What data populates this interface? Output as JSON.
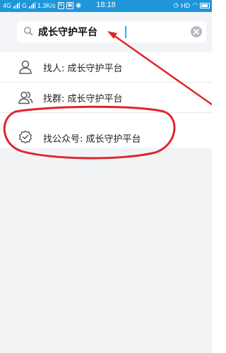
{
  "status_bar": {
    "network_1": "4G",
    "network_2": "G",
    "speed": "1.3K/s",
    "time": "18:18",
    "hd": "HD"
  },
  "search": {
    "query": "成长守护平台",
    "icon": "search-icon",
    "clear_icon": "clear-icon"
  },
  "results": [
    {
      "icon": "person-icon",
      "label": "找人: 成长守护平台"
    },
    {
      "icon": "group-icon",
      "label": "找群: 成长守护平台"
    },
    {
      "icon": "verified-badge-icon",
      "label": "找公众号: 成长守护平台"
    }
  ],
  "colors": {
    "status_bar": "#1e96d9",
    "header_bg": "#f2f4f7",
    "annotation_red": "#e0252b",
    "cursor": "#12b7f5"
  }
}
